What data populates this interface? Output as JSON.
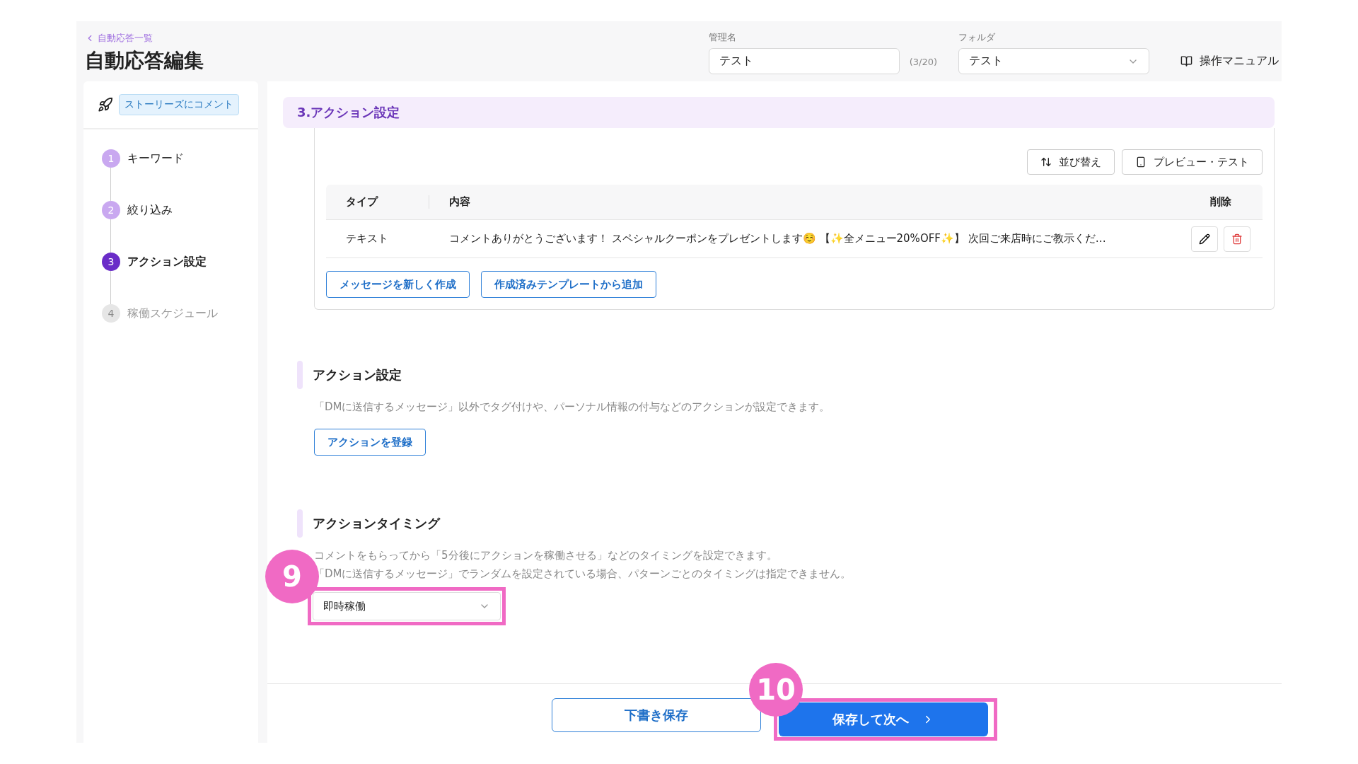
{
  "header": {
    "back_link": "自動応答一覧",
    "title": "自動応答編集",
    "name_field": {
      "label": "管理名",
      "value": "テスト",
      "count": "(3/20)"
    },
    "folder_field": {
      "label": "フォルダ",
      "value": "テスト"
    },
    "manual_link": "操作マニュアル"
  },
  "sidebar": {
    "trigger_tag": "ストーリーズにコメント",
    "steps": [
      {
        "number": "1",
        "label": "キーワード",
        "completed": true,
        "selected": false
      },
      {
        "number": "2",
        "label": "絞り込み",
        "completed": true,
        "selected": false
      },
      {
        "number": "3",
        "label": "アクション設定",
        "completed": false,
        "selected": true
      },
      {
        "number": "4",
        "label": "稼働スケジュール",
        "completed": false,
        "selected": false
      }
    ]
  },
  "section_title": "3.アクション設定",
  "messages": {
    "toolbar": [
      "並び替え",
      "プレビュー・テスト"
    ],
    "columns": [
      "タイプ",
      "内容",
      "削除"
    ],
    "rows": [
      {
        "type": "テキスト",
        "content": "コメントありがとうございます！ スペシャルクーポンをプレゼントします☺️ 【✨全メニュー20%OFF✨】 次回ご来店時にご教示くだ…"
      }
    ],
    "buttons": [
      "メッセージを新しく作成",
      "作成済みテンプレートから追加"
    ]
  },
  "action_settings": {
    "title": "アクション設定",
    "description": "「DMに送信するメッセージ」以外でタグ付けや、パーソナル情報の付与などのアクションが設定できます。",
    "button": "アクションを登録"
  },
  "action_timing": {
    "title": "アクションタイミング",
    "description": [
      "コメントをもらってから「5分後にアクションを稼働させる」などのタイミングを設定できます。",
      "「DMに送信するメッセージ」でランダムを設定されている場合、パターンごとのタイミングは指定できません。"
    ],
    "select_value": "即時稼働"
  },
  "footer": {
    "draft_button": "下書き保存",
    "next_button": "保存して次へ"
  },
  "annotations": [
    {
      "label": "9"
    },
    {
      "label": "10"
    }
  ]
}
